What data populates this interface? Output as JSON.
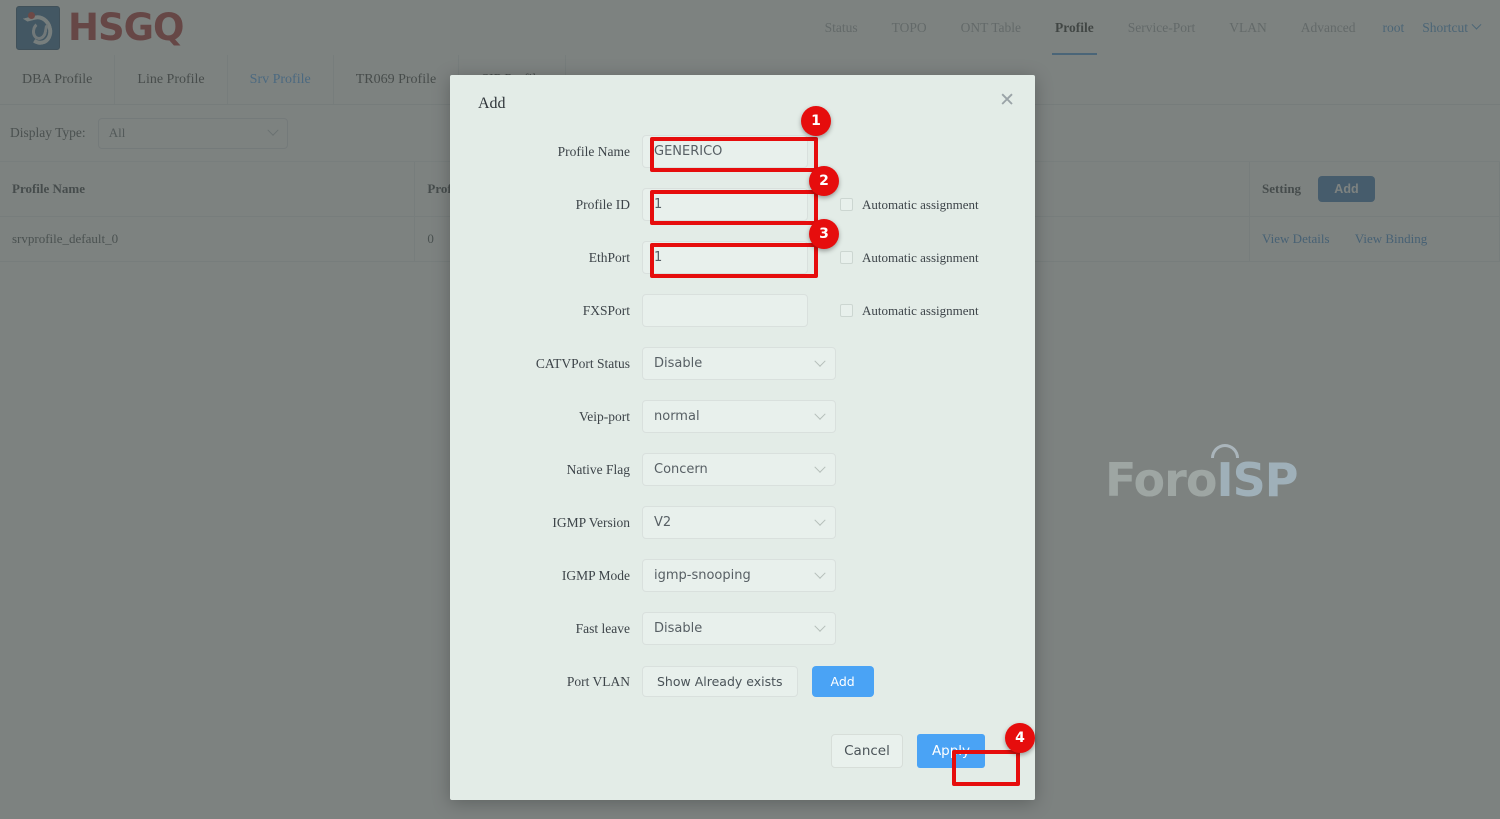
{
  "brand": {
    "name": "HSGQ",
    "logo_icon": "hsgq-logo-icon"
  },
  "mainnav": {
    "items": [
      {
        "label": "Status",
        "active": false
      },
      {
        "label": "TOPO",
        "active": false
      },
      {
        "label": "ONT Table",
        "active": false
      },
      {
        "label": "Profile",
        "active": true
      },
      {
        "label": "Service-Port",
        "active": false
      },
      {
        "label": "VLAN",
        "active": false
      },
      {
        "label": "Advanced",
        "active": false
      }
    ],
    "user": "root",
    "shortcut": "Shortcut",
    "shortcut_icon": "chevron-down-icon"
  },
  "subtabs": [
    {
      "label": "DBA Profile",
      "active": false
    },
    {
      "label": "Line Profile",
      "active": false
    },
    {
      "label": "Srv Profile",
      "active": true
    },
    {
      "label": "TR069 Profile",
      "active": false
    },
    {
      "label": "SIP Profile",
      "active": false
    }
  ],
  "filter": {
    "label": "Display Type:",
    "value": "All",
    "caret_icon": "chevron-down-icon"
  },
  "table": {
    "columns": [
      "Profile Name",
      "Profile ID",
      "",
      "Setting"
    ],
    "add_label": "Add",
    "rows": [
      {
        "profile_name": "srvprofile_default_0",
        "profile_id": "0",
        "extra": "",
        "actions": [
          "View Details",
          "View Binding"
        ]
      }
    ]
  },
  "watermark": {
    "part1": "Foro",
    "part2": "ISP"
  },
  "dialog": {
    "title": "Add",
    "close_icon": "close-icon",
    "fields": [
      {
        "label": "Profile Name",
        "type": "input",
        "value": "GENERICO",
        "placeholder": "",
        "auto": null
      },
      {
        "label": "Profile ID",
        "type": "input",
        "value": "1",
        "placeholder": "",
        "auto": "Automatic assignment"
      },
      {
        "label": "EthPort",
        "type": "input",
        "value": "1",
        "placeholder": "",
        "auto": "Automatic assignment"
      },
      {
        "label": "FXSPort",
        "type": "input",
        "value": "",
        "placeholder": "",
        "auto": "Automatic assignment"
      },
      {
        "label": "CATVPort Status",
        "type": "select",
        "value": "Disable",
        "auto": null
      },
      {
        "label": "Veip-port",
        "type": "select",
        "value": "normal",
        "auto": null
      },
      {
        "label": "Native Flag",
        "type": "select",
        "value": "Concern",
        "auto": null
      },
      {
        "label": "IGMP Version",
        "type": "select",
        "value": "V2",
        "auto": null
      },
      {
        "label": "IGMP Mode",
        "type": "select",
        "value": "igmp-snooping",
        "auto": null
      },
      {
        "label": "Fast leave",
        "type": "select",
        "value": "Disable",
        "auto": null
      }
    ],
    "port_vlan": {
      "label": "Port VLAN",
      "show_label": "Show Already exists",
      "add_label": "Add"
    },
    "footer": {
      "cancel_label": "Cancel",
      "apply_label": "Apply"
    }
  },
  "annotations": {
    "accent_color": "#e60d0d",
    "steps": [
      {
        "number": "1",
        "target": "profile-name-input"
      },
      {
        "number": "2",
        "target": "profile-id-input"
      },
      {
        "number": "3",
        "target": "ethport-input"
      },
      {
        "number": "4",
        "target": "apply-button"
      }
    ]
  }
}
